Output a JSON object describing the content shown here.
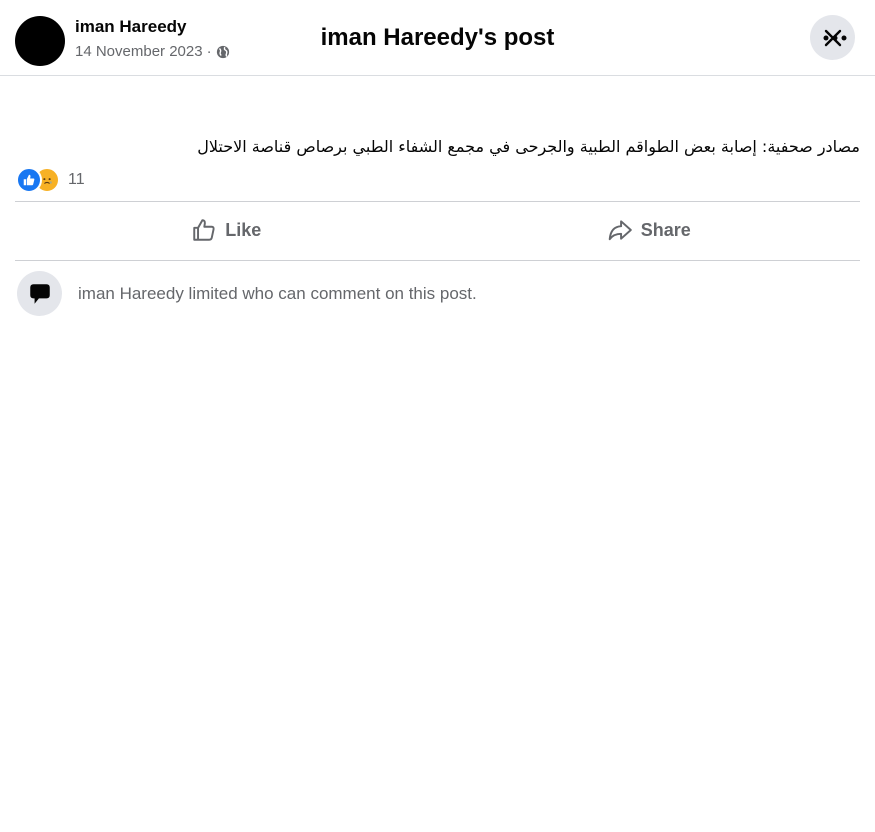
{
  "dialog": {
    "title": "iman Hareedy's post",
    "close_icon": "close-icon"
  },
  "post": {
    "author": "iman Hareedy",
    "date": "14 November 2023",
    "separator": "·",
    "audience_icon": "globe-icon",
    "more_icon": "more-options-icon",
    "text": "مصادر صحفية: إصابة بعض الطواقم الطبية والجرحى في مجمع الشفاء الطبي برصاص قناصة الاحتلال",
    "reactions": {
      "types": [
        "like",
        "sad"
      ],
      "count": "11"
    }
  },
  "actions": {
    "like_label": "Like",
    "share_label": "Share"
  },
  "comments": {
    "notice": "iman Hareedy limited who can comment on this post."
  },
  "colors": {
    "like_blue": "#1877f2",
    "sad_yellow": "#f7b125",
    "secondary_text": "#65676b",
    "divider": "#ced0d4"
  }
}
